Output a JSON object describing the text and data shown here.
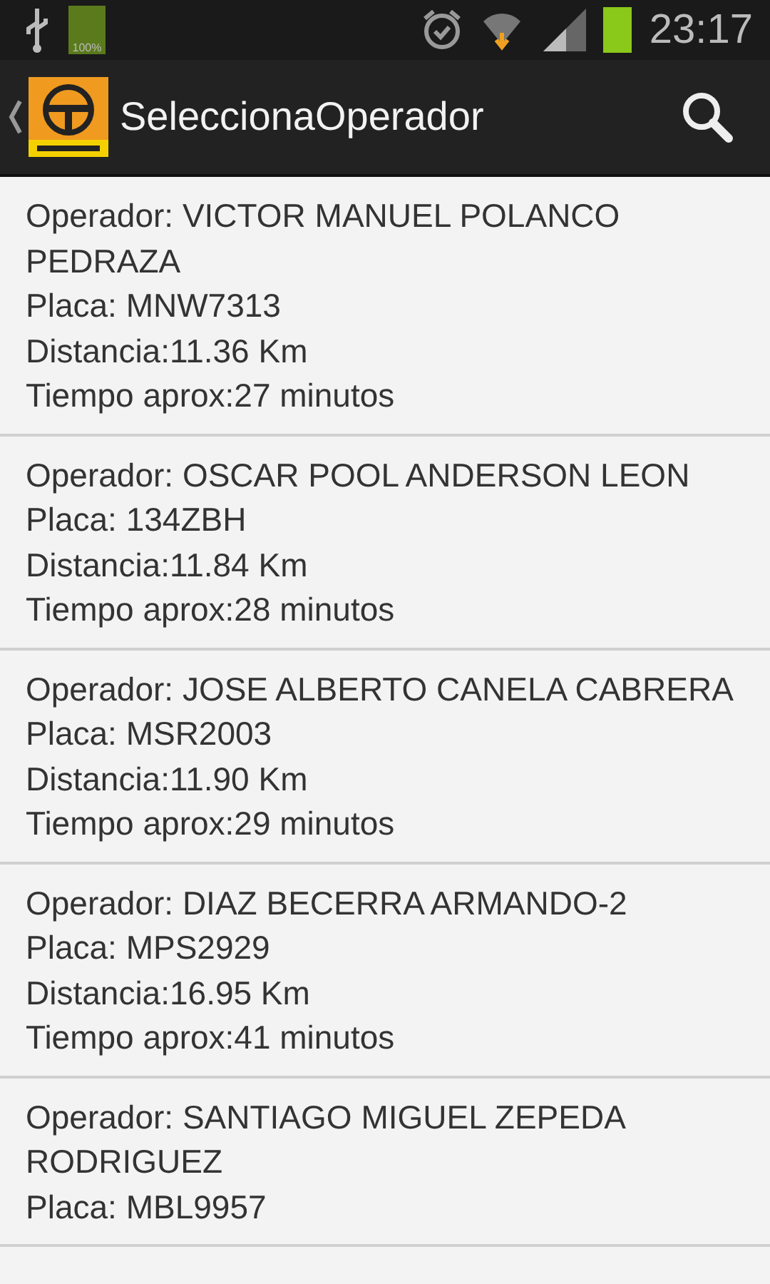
{
  "status_bar": {
    "battery_label": "100%",
    "time": "23:17"
  },
  "action_bar": {
    "title": "SeleccionaOperador"
  },
  "operators": [
    {
      "operator": "Operador: VICTOR MANUEL POLANCO PEDRAZA",
      "plate": "Placa: MNW7313",
      "distance": "Distancia:11.36 Km",
      "time": "Tiempo aprox:27 minutos"
    },
    {
      "operator": "Operador: OSCAR POOL ANDERSON LEON",
      "plate": "Placa: 134ZBH",
      "distance": "Distancia:11.84 Km",
      "time": "Tiempo aprox:28 minutos"
    },
    {
      "operator": "Operador: JOSE ALBERTO CANELA CABRERA",
      "plate": "Placa: MSR2003",
      "distance": "Distancia:11.90 Km",
      "time": "Tiempo aprox:29 minutos"
    },
    {
      "operator": "Operador: DIAZ BECERRA ARMANDO-2",
      "plate": "Placa: MPS2929",
      "distance": "Distancia:16.95 Km",
      "time": "Tiempo aprox:41 minutos"
    },
    {
      "operator": "Operador: SANTIAGO MIGUEL ZEPEDA RODRIGUEZ",
      "plate": "Placa: MBL9957"
    }
  ]
}
